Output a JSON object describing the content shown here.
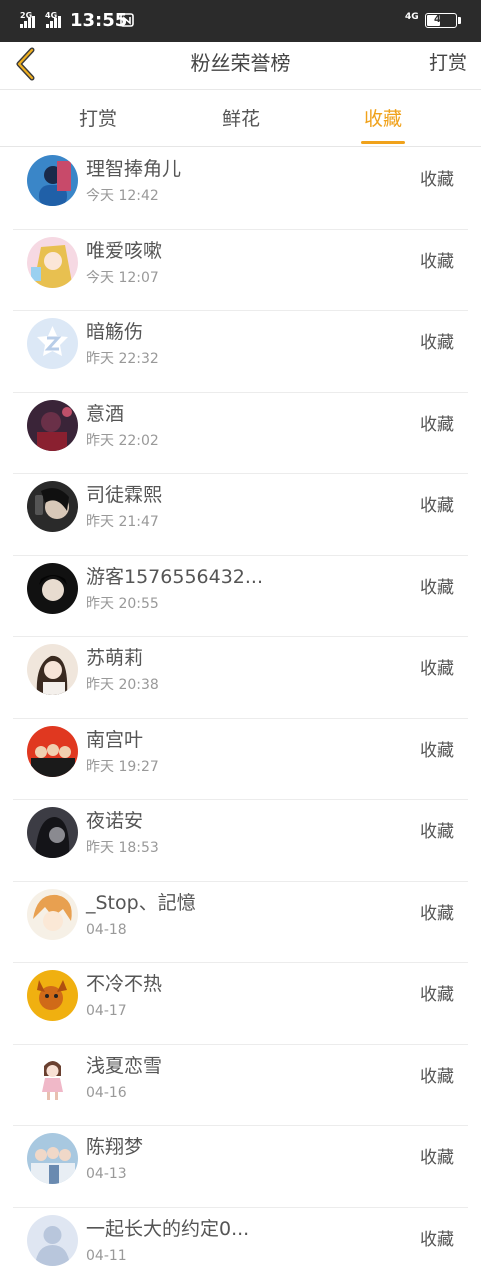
{
  "status_bar": {
    "net_left_1": "2G",
    "net_left_2": "4G",
    "time": "13:55",
    "net_right": "4G",
    "battery_level": 47,
    "battery_text": "47"
  },
  "header": {
    "back_icon": "chevron-left-icon",
    "title": "粉丝荣誉榜",
    "action": "打赏"
  },
  "tabs": [
    {
      "label": "打赏",
      "active": false
    },
    {
      "label": "鲜花",
      "active": false
    },
    {
      "label": "收藏",
      "active": true
    }
  ],
  "accent_color": "#f0a21b",
  "list": [
    {
      "name": "理智捧角儿",
      "time": "今天 12:42",
      "action": "收藏"
    },
    {
      "name": "唯爱咳嗽",
      "time": "今天 12:07",
      "action": "收藏"
    },
    {
      "name": "暗觞伤",
      "time": "昨天 22:32",
      "action": "收藏"
    },
    {
      "name": "意酒",
      "time": "昨天 22:02",
      "action": "收藏"
    },
    {
      "name": "司徒霖熙",
      "time": "昨天 21:47",
      "action": "收藏"
    },
    {
      "name": "游客1576556432...",
      "time": "昨天 20:55",
      "action": "收藏"
    },
    {
      "name": "苏萌莉",
      "time": "昨天 20:38",
      "action": "收藏"
    },
    {
      "name": "南宫叶",
      "time": "昨天 19:27",
      "action": "收藏"
    },
    {
      "name": "夜诺安",
      "time": "昨天 18:53",
      "action": "收藏"
    },
    {
      "name": "_Stop、記憶",
      "time": "04-18",
      "action": "收藏"
    },
    {
      "name": "不冷不热",
      "time": "04-17",
      "action": "收藏"
    },
    {
      "name": "浅夏恋雪",
      "time": "04-16",
      "action": "收藏"
    },
    {
      "name": "陈翔梦",
      "time": "04-13",
      "action": "收藏"
    },
    {
      "name": "一起长大的约定0...",
      "time": "04-11",
      "action": "收藏"
    }
  ]
}
